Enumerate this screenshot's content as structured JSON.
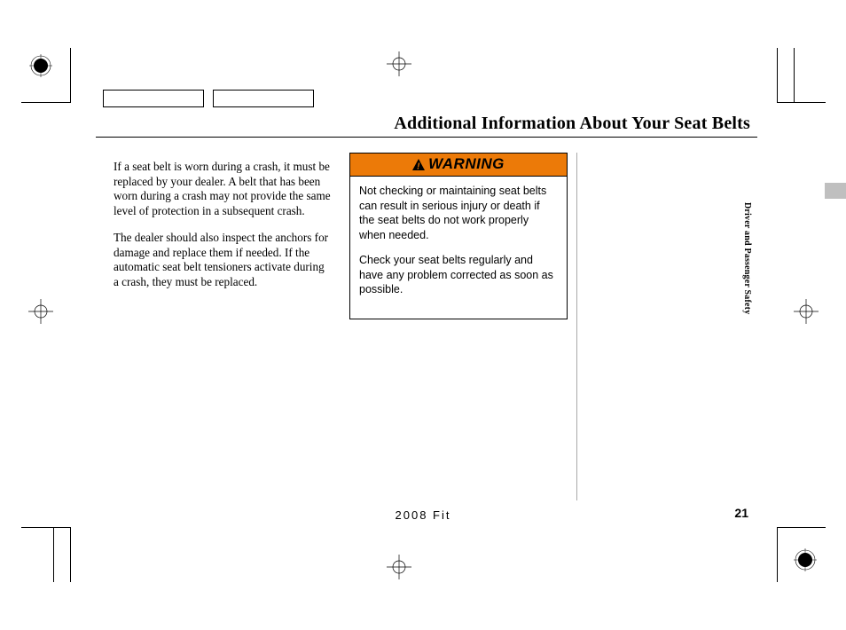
{
  "heading": "Additional Information About Your Seat Belts",
  "body": {
    "p1": "If a seat belt is worn during a crash, it must be replaced by your dealer. A belt that has been worn during a crash may not provide the same level of protection in a subsequent crash.",
    "p2": "The dealer should also inspect the anchors for damage and replace them if needed. If the automatic seat belt tensioners activate during a crash, they must be replaced."
  },
  "warning": {
    "label": "WARNING",
    "p1": "Not checking or maintaining seat belts can result in serious injury or death if the seat belts do not work properly when needed.",
    "p2": "Check your seat belts regularly and have any problem corrected as soon as possible."
  },
  "side_tab": "Driver and Passenger Safety",
  "footer": {
    "model": "2008  Fit",
    "page": "21"
  }
}
